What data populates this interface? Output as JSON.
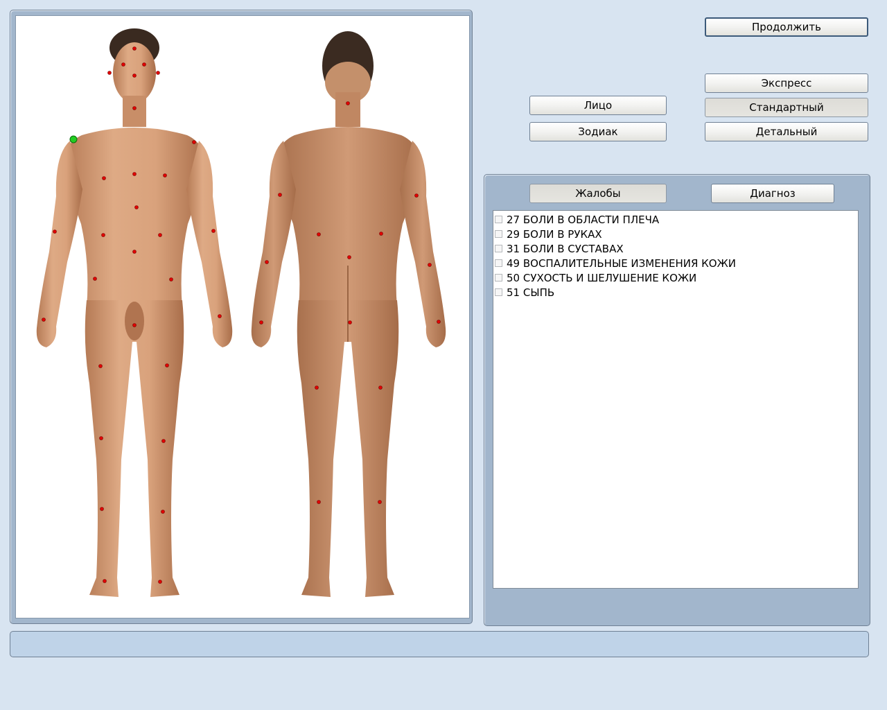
{
  "buttons": {
    "continue": "Продолжить",
    "express": "Экспресс",
    "standard": "Стандартный",
    "detailed": "Детальный",
    "face": "Лицо",
    "zodiac": "Зодиак"
  },
  "tabs": {
    "complaints": "Жалобы",
    "diagnosis": "Диагноз"
  },
  "complaints": [
    "27 БОЛИ В ОБЛАСТИ ПЛЕЧА",
    "29 БОЛИ В РУКАХ",
    "31 БОЛИ В СУСТАВАХ",
    "49 ВОСПАЛИТЕЛЬНЫЕ ИЗМЕНЕНИЯ КОЖИ",
    "50 СУХОСТЬ И ШЕЛУШЕНИЕ КОЖИ",
    "51 СЫПЬ"
  ],
  "status_text": "",
  "colors": {
    "background": "#d8e4f1",
    "panel": "#a2b6cc",
    "point_marker": "#e00000",
    "selected_marker": "#22cc22",
    "skin": "#d19a74"
  },
  "body_figures": [
    "front-view",
    "back-view"
  ]
}
